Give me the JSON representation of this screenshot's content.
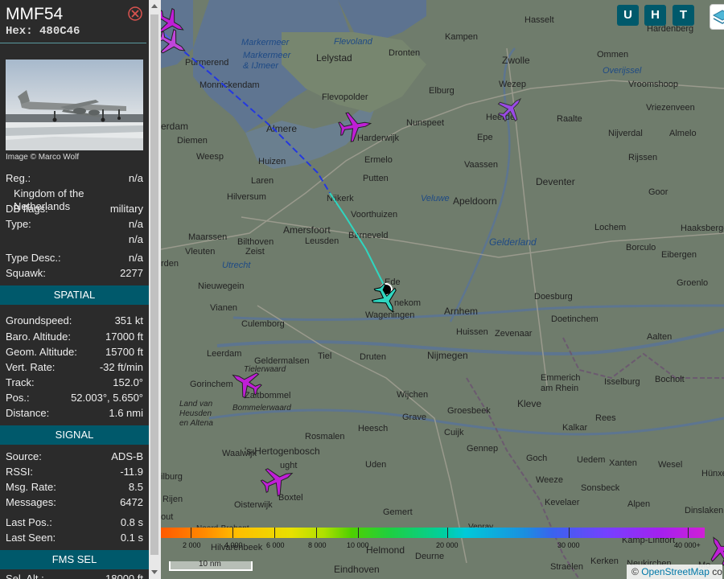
{
  "sidebar": {
    "callsign": "MMF54",
    "hex_label": "Hex:",
    "hex_value": "480C46",
    "photo_credit": "Image © Marco Wolf",
    "info": [
      {
        "key": "Reg.:",
        "value": "n/a"
      },
      {
        "key": "",
        "value": "Kingdom of the Netherlands"
      },
      {
        "key": "DB flags:",
        "value": "military"
      },
      {
        "key": "Type:",
        "value": "n/a"
      },
      {
        "key": "",
        "value": "n/a"
      },
      {
        "key": "Type Desc.:",
        "value": "n/a"
      },
      {
        "key": "Squawk:",
        "value": "2277"
      }
    ],
    "spatial_title": "SPATIAL",
    "spatial": [
      {
        "key": "Groundspeed:",
        "value": "351 kt"
      },
      {
        "key": "Baro. Altitude:",
        "value": "17000 ft"
      },
      {
        "key": "Geom. Altitude:",
        "value": "15700 ft"
      },
      {
        "key": "Vert. Rate:",
        "value": "-32 ft/min"
      },
      {
        "key": "Track:",
        "value": "152.0°"
      },
      {
        "key": "Pos.:",
        "value": "52.003°, 5.650°"
      },
      {
        "key": "Distance:",
        "value": "1.6 nmi"
      }
    ],
    "signal_title": "SIGNAL",
    "signal": [
      {
        "key": "Source:",
        "value": "ADS-B"
      },
      {
        "key": "RSSI:",
        "value": "-11.9"
      },
      {
        "key": "Msg. Rate:",
        "value": "8.5"
      },
      {
        "key": "Messages:",
        "value": "6472"
      },
      {
        "key": "Last Pos.:",
        "value": "0.8 s"
      },
      {
        "key": "Last Seen:",
        "value": "0.1 s"
      }
    ],
    "fms_title": "FMS SEL",
    "fms_partial_key": "Sel. Alt.:",
    "fms_partial_value": "18000 ft"
  },
  "map": {
    "buttons": [
      "U",
      "H",
      "T"
    ],
    "labels": {
      "markermeer": "Markermeer",
      "markermeer_ijmeer": "Markermeer\n& IJmeer",
      "flevoland": "Flevoland",
      "flevopolder": "Flevopolder",
      "lelystad": "Lelystad",
      "kampen": "Kampen",
      "hasselt": "Hasselt",
      "hardenberg": "Hardenberg",
      "dronten": "Dronten",
      "zwolle": "Zwolle",
      "ommen": "Ommen",
      "overijssel": "Overijssel",
      "wezep": "Wezep",
      "vroomshoop": "Vroomshoop",
      "elburg": "Elburg",
      "vriezenveen": "Vriezenveen",
      "purmerend": "Purmerend",
      "monnickendam": "Monnickendam",
      "amsterdam_frag": "erdam",
      "almere": "Almere",
      "harderwijk": "Harderwijk",
      "nunspeet": "Nunspeet",
      "heerde": "Heerde",
      "raalte": "Raalte",
      "nijverdal": "Nijverdal",
      "almelo": "Almelo",
      "diemen": "Diemen",
      "epe": "Epe",
      "rijssen": "Rijssen",
      "weesp": "Weesp",
      "huizen": "Huizen",
      "ermelo": "Ermelo",
      "vaassen": "Vaassen",
      "deventer": "Deventer",
      "goor": "Goor",
      "laren": "Laren",
      "putten": "Putten",
      "veluwe": "Veluwe",
      "apeldoorn": "Apeldoorn",
      "hilversum": "Hilversum",
      "nijkerk": "Nijkerk",
      "voorthuizen": "Voorthuizen",
      "haaksbergen": "Haaksbergen",
      "amersfoort": "Amersfoort",
      "barneveld": "Barneveld",
      "lochem": "Lochem",
      "maarssen": "Maarssen",
      "bilthoven": "Bilthoven",
      "leusden": "Leusden",
      "gelderland": "Gelderland",
      "borculo": "Borculo",
      "vleuten": "Vleuten",
      "zeist": "Zeist",
      "eibergen": "Eibergen",
      "utrecht": "Utrecht",
      "ede": "Ede",
      "groenlo": "Groenlo",
      "nieuwegein": "Nieuwegein",
      "bennekom": "nekom",
      "arnhem": "Arnhem",
      "doesburg": "Doesburg",
      "vianen": "Vianen",
      "wageningen": "Wageningen",
      "doetinchem": "Doetinchem",
      "culemborg": "Culemborg",
      "huissen": "Huissen",
      "zevenaar": "Zevenaar",
      "aalten": "Aalten",
      "leerdam": "Leerdam",
      "geldermalsen": "Geldermalsen",
      "tiel": "Tiel",
      "druten": "Druten",
      "nijmegen": "Nijmegen",
      "tielerwaard": "Tielerwaard",
      "emmerich": "Emmerich\nam Rhein",
      "isselburg": "Isselburg",
      "bocholt": "Bocholt",
      "gorinchem": "Gorinchem",
      "zaltbommel": "Zaltbommel",
      "wijchen": "Wijchen",
      "kleve": "Kleve",
      "bommelerwaard": "Bommelerwaard",
      "groesbeek": "Groesbeek",
      "land_van_heusden": "Land van\nHeusden\nen Altena",
      "grave": "Grave",
      "kalkar": "Kalkar",
      "rees": "Rees",
      "cuijk": "Cuijk",
      "rosmalen": "Rosmalen",
      "heesch": "Heesch",
      "gennep": "Gennep",
      "waalwijk": "Waalwijk",
      "hertogenbosch": "'s-Hertogenbosch",
      "goch": "Goch",
      "uedem": "Uedem",
      "xanten": "Xanten",
      "wesel": "Wesel",
      "uden": "Uden",
      "vught_frag": "ught",
      "weeze": "Weeze",
      "hunxe": "Hünxe",
      "tilburg_frag": "ilburg",
      "boxtel": "Boxtel",
      "sonsbeck": "Sonsbeck",
      "oisterwijk": "Oisterwijk",
      "kevelaer": "Kevelaer",
      "alpen": "Alpen",
      "dinslaken": "Dinslaken",
      "rijen_frag": "Rijen",
      "gemert": "Gemert",
      "oosterhout_frag": "out",
      "noord_brabant_frag": "Noord-Brabant",
      "hilvarenbeek_frag": "Hilvarenbeek",
      "venray": "Venray",
      "kamp_lintfort": "Kamp-Lintfort",
      "helmond": "Helmond",
      "deurne": "Deurne",
      "eindhoven": "Eindhoven",
      "straelen": "Straelen",
      "kerken": "Kerken",
      "neukirchen": "Neukirchen",
      "moers_frag": "Mo",
      "utr_frag": "rden"
    },
    "altitude_scale": [
      "2 000",
      "4 000",
      "6 000",
      "8 000",
      "10 000",
      "20 000",
      "30 000",
      "40 000+"
    ],
    "distance_scale": "10 nm",
    "attribution_prefix": "© ",
    "attribution_link": "OpenStreetMap",
    "attribution_suffix": " co"
  },
  "colors": {
    "sidebar_bg": "#2b2b2b",
    "section_bg": "#00596b",
    "button_bg": "#00596b",
    "selected_aircraft": "#2fd6c0",
    "aircraft_magenta": "#bf1fd6",
    "aircraft_violet": "#8a3ce0",
    "map_bg": "#6e7b6b",
    "water": "#5f7591"
  }
}
